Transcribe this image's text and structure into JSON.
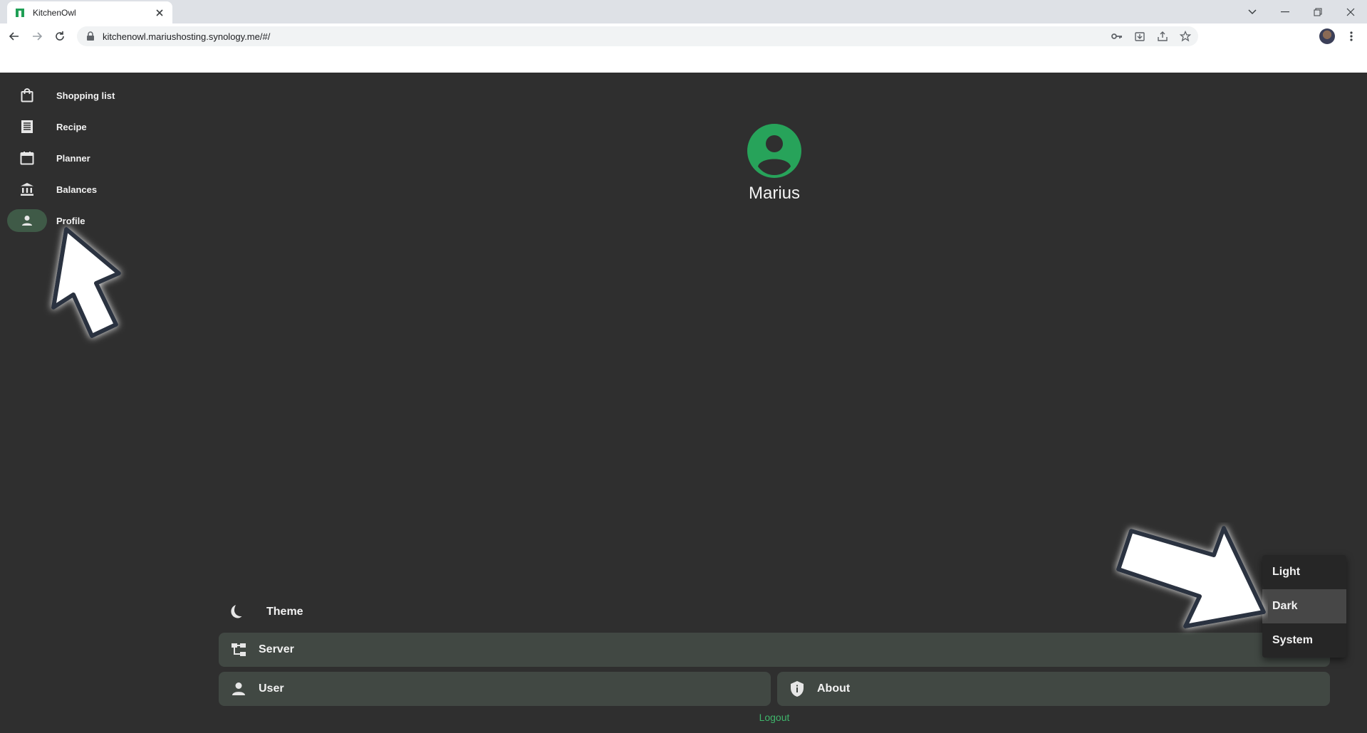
{
  "browser": {
    "tab_title": "KitchenOwl",
    "url": "kitchenowl.mariushosting.synology.me/#/"
  },
  "sidebar": {
    "items": [
      {
        "label": "Shopping list",
        "icon": "shopping-bag-icon"
      },
      {
        "label": "Recipe",
        "icon": "recipe-icon"
      },
      {
        "label": "Planner",
        "icon": "calendar-icon"
      },
      {
        "label": "Balances",
        "icon": "bank-icon"
      },
      {
        "label": "Profile",
        "icon": "person-icon",
        "active": true
      }
    ]
  },
  "profile": {
    "name": "Marius",
    "avatar_color": "#27a35a"
  },
  "settings": {
    "theme_label": "Theme",
    "server_label": "Server",
    "user_label": "User",
    "about_label": "About",
    "logout_label": "Logout"
  },
  "theme_menu": {
    "options": [
      "Light",
      "Dark",
      "System"
    ],
    "selected": "Dark"
  },
  "colors": {
    "background": "#2f2f2f",
    "card": "#414843",
    "accent": "#3fb56b",
    "active_nav": "#3f5a47"
  }
}
